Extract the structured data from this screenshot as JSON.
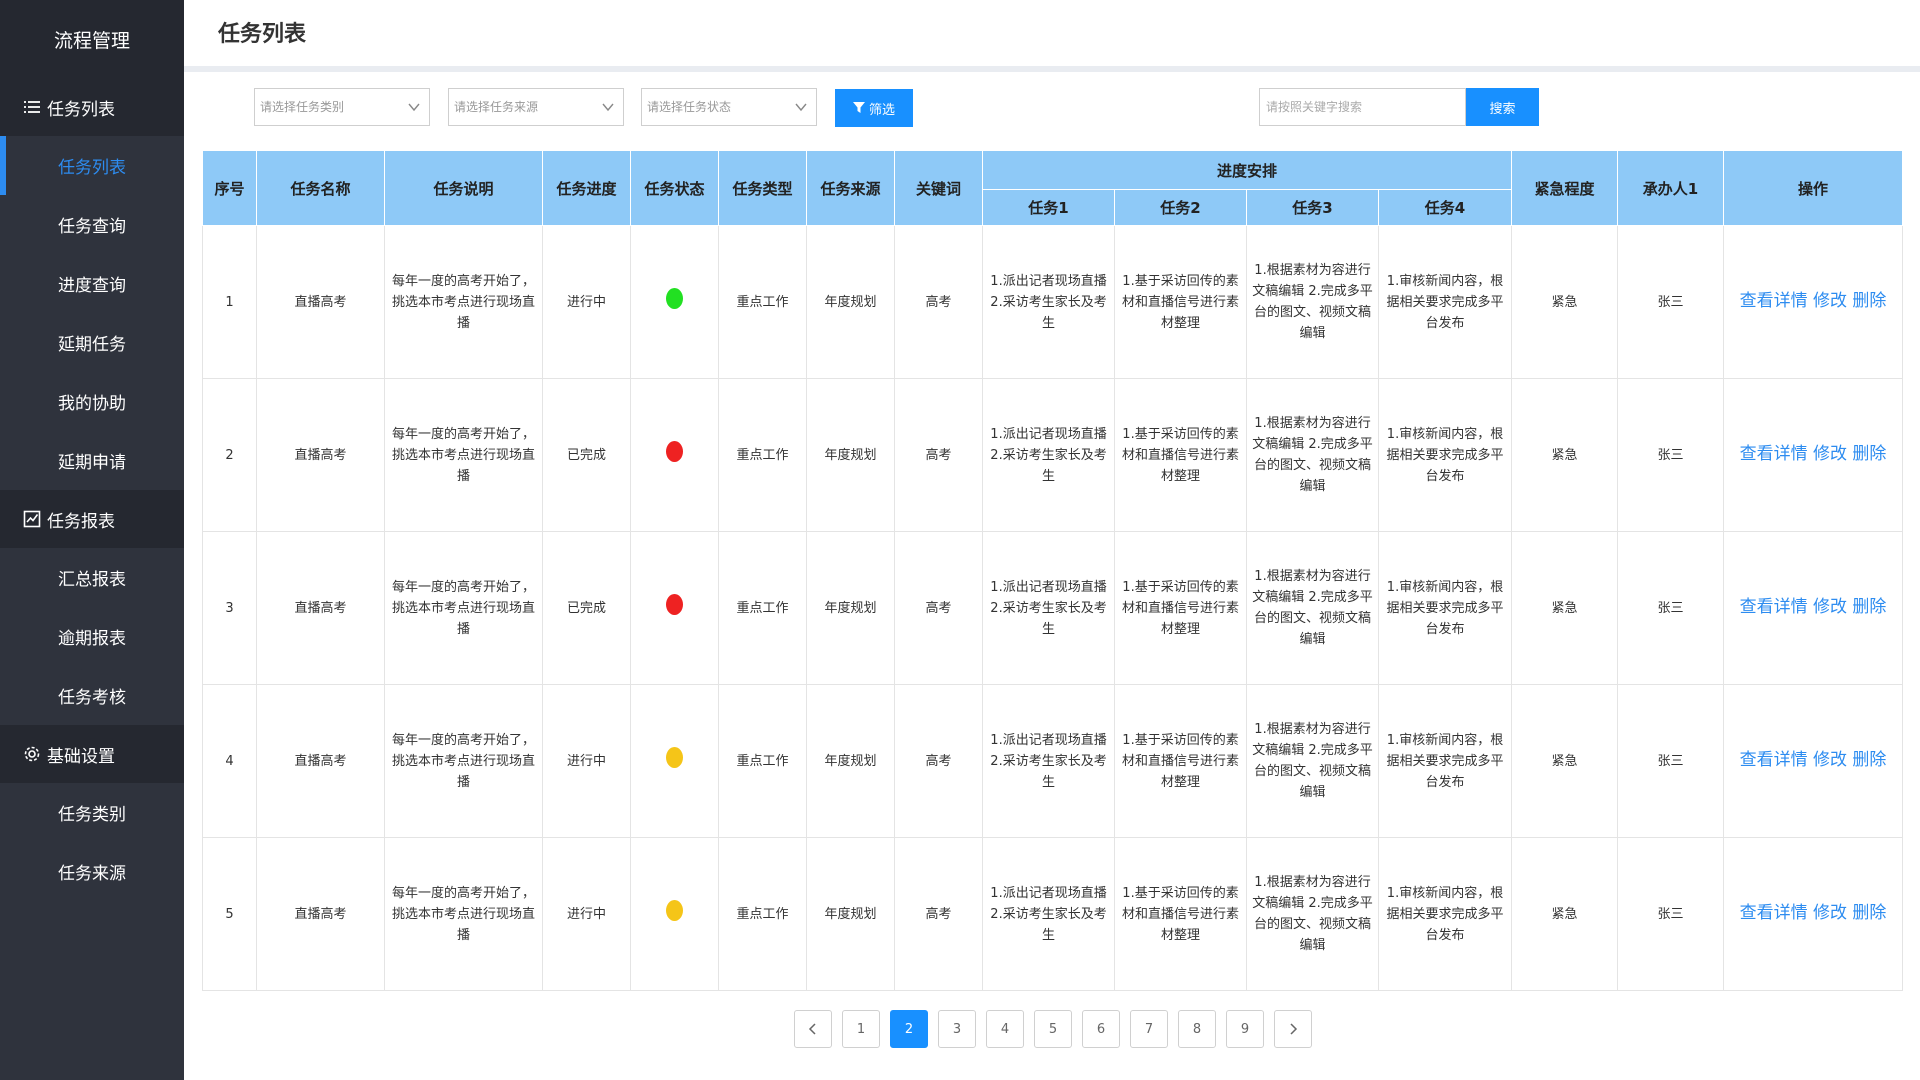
{
  "sidebar": {
    "brand": "流程管理",
    "groups": [
      {
        "label": "任务列表",
        "icon": "list-icon",
        "items": [
          "任务列表",
          "任务查询",
          "进度查询",
          "延期任务",
          "我的协助",
          "延期申请"
        ]
      },
      {
        "label": "任务报表",
        "icon": "chart-check-icon",
        "items": [
          "汇总报表",
          "逾期报表",
          "任务考核"
        ]
      },
      {
        "label": "基础设置",
        "icon": "gear-icon",
        "items": [
          "任务类别",
          "任务来源"
        ]
      }
    ],
    "active_item": "任务列表"
  },
  "header": {
    "title": "任务列表"
  },
  "filters": {
    "category_placeholder": "请选择任务类别",
    "source_placeholder": "请选择任务来源",
    "status_placeholder": "请选择任务状态",
    "filter_button": "筛选",
    "search_placeholder": "请按照关键字搜索",
    "search_button": "搜索"
  },
  "table": {
    "columns": [
      "序号",
      "任务名称",
      "任务说明",
      "任务进度",
      "任务状态",
      "任务类型",
      "任务来源",
      "关键词",
      "进度安排",
      "紧急程度",
      "承办人1",
      "操作"
    ],
    "progress_subcolumns": [
      "任务1",
      "任务2",
      "任务3",
      "任务4"
    ],
    "rows": [
      {
        "no": "1",
        "name": "直播高考",
        "desc": "每年一度的高考开始了，挑选本市考点进行现场直播",
        "progress": "进行中",
        "status_color": "#22e022",
        "type": "重点工作",
        "source": "年度规划",
        "keyword": "高考",
        "t1": "1.派出记者现场直播 2.采访考生家长及考生",
        "t2": "1.基于采访回传的素材和直播信号进行素材整理",
        "t3": "1.根据素材为容进行文稿编辑 2.完成多平台的图文、视频文稿编辑",
        "t4": "1.审核新闻内容，根据相关要求完成多平台发布",
        "urgency": "紧急",
        "owner": "张三"
      },
      {
        "no": "2",
        "name": "直播高考",
        "desc": "每年一度的高考开始了，挑选本市考点进行现场直播",
        "progress": "已完成",
        "status_color": "#ee2222",
        "type": "重点工作",
        "source": "年度规划",
        "keyword": "高考",
        "t1": "1.派出记者现场直播 2.采访考生家长及考生",
        "t2": "1.基于采访回传的素材和直播信号进行素材整理",
        "t3": "1.根据素材为容进行文稿编辑 2.完成多平台的图文、视频文稿编辑",
        "t4": "1.审核新闻内容，根据相关要求完成多平台发布",
        "urgency": "紧急",
        "owner": "张三"
      },
      {
        "no": "3",
        "name": "直播高考",
        "desc": "每年一度的高考开始了，挑选本市考点进行现场直播",
        "progress": "已完成",
        "status_color": "#ee2222",
        "type": "重点工作",
        "source": "年度规划",
        "keyword": "高考",
        "t1": "1.派出记者现场直播 2.采访考生家长及考生",
        "t2": "1.基于采访回传的素材和直播信号进行素材整理",
        "t3": "1.根据素材为容进行文稿编辑 2.完成多平台的图文、视频文稿编辑",
        "t4": "1.审核新闻内容，根据相关要求完成多平台发布",
        "urgency": "紧急",
        "owner": "张三"
      },
      {
        "no": "4",
        "name": "直播高考",
        "desc": "每年一度的高考开始了，挑选本市考点进行现场直播",
        "progress": "进行中",
        "status_color": "#f5c518",
        "type": "重点工作",
        "source": "年度规划",
        "keyword": "高考",
        "t1": "1.派出记者现场直播 2.采访考生家长及考生",
        "t2": "1.基于采访回传的素材和直播信号进行素材整理",
        "t3": "1.根据素材为容进行文稿编辑 2.完成多平台的图文、视频文稿编辑",
        "t4": "1.审核新闻内容，根据相关要求完成多平台发布",
        "urgency": "紧急",
        "owner": "张三"
      },
      {
        "no": "5",
        "name": "直播高考",
        "desc": "每年一度的高考开始了，挑选本市考点进行现场直播",
        "progress": "进行中",
        "status_color": "#f5c518",
        "type": "重点工作",
        "source": "年度规划",
        "keyword": "高考",
        "t1": "1.派出记者现场直播 2.采访考生家长及考生",
        "t2": "1.基于采访回传的素材和直播信号进行素材整理",
        "t3": "1.根据素材为容进行文稿编辑 2.完成多平台的图文、视频文稿编辑",
        "t4": "1.审核新闻内容，根据相关要求完成多平台发布",
        "urgency": "紧急",
        "owner": "张三"
      }
    ],
    "actions": {
      "view": "查看详情",
      "edit": "修改",
      "delete": "删除"
    }
  },
  "pagination": {
    "pages": [
      "1",
      "2",
      "3",
      "4",
      "5",
      "6",
      "7",
      "8",
      "9"
    ],
    "current": "2",
    "prev_icon": "chevron-left-icon",
    "next_icon": "chevron-right-icon"
  },
  "colors": {
    "accent": "#1890ff",
    "sidebar": "#2f333d",
    "sidebar_dark": "#252830",
    "table_header": "#8ec9f7"
  }
}
